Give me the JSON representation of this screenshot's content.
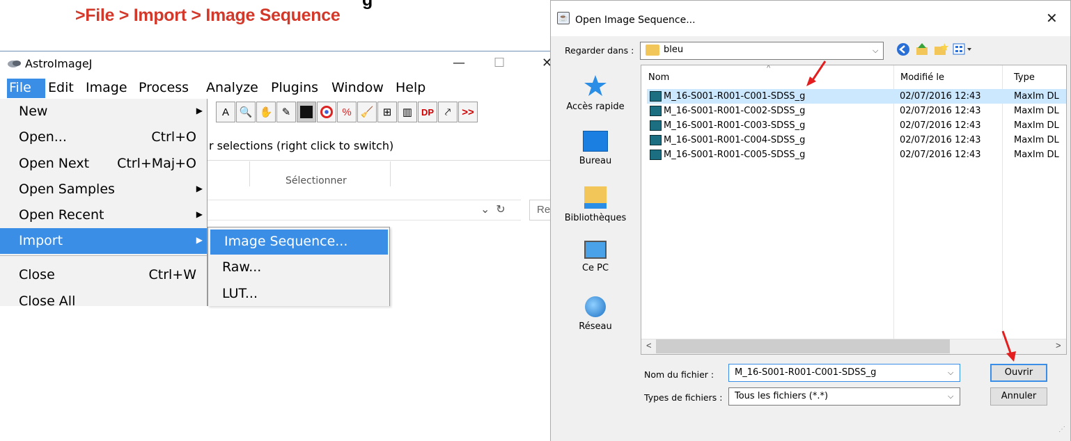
{
  "caption": ">File > Import > Image Sequence",
  "caption_cut": "g",
  "astroimagej": {
    "title": "AstroImageJ",
    "window_controls": {
      "minimize": "—",
      "maximize": "☐",
      "close": "✕"
    },
    "menu": [
      "File",
      "Edit",
      "Image",
      "Process",
      "Analyze",
      "Plugins",
      "Window",
      "Help"
    ],
    "toolbar": [
      "A",
      "🔍",
      "✋",
      "✎",
      "▦",
      "◉",
      "%",
      "🧹",
      "⊞",
      "▥",
      "DP",
      "⤤",
      ">>"
    ],
    "status": "r selections (right click to switch)",
    "file_menu": [
      {
        "label": "New",
        "shortcut": "",
        "submenu": true
      },
      {
        "label": "Open...",
        "shortcut": "Ctrl+O",
        "submenu": false
      },
      {
        "label": "Open Next",
        "shortcut": "Ctrl+Maj+O",
        "submenu": false
      },
      {
        "label": "Open Samples",
        "shortcut": "",
        "submenu": true
      },
      {
        "label": "Open Recent",
        "shortcut": "",
        "submenu": true
      },
      {
        "label": "Import",
        "shortcut": "",
        "submenu": true
      },
      {
        "label": "Close",
        "shortcut": "Ctrl+W",
        "submenu": false
      },
      {
        "label": "Close All",
        "shortcut": "",
        "submenu": false
      }
    ],
    "import_submenu": [
      "Image Sequence...",
      "Raw...",
      "LUT..."
    ]
  },
  "background": {
    "ribbon_label": "Sélectionner",
    "search_partial": "Re"
  },
  "dialog": {
    "title": "Open Image Sequence...",
    "close": "✕",
    "look_in_label": "Regarder dans :",
    "look_in_value": "bleu",
    "places": [
      "Accès rapide",
      "Bureau",
      "Bibliothèques",
      "Ce PC",
      "Réseau"
    ],
    "columns": {
      "name": "Nom",
      "modified": "Modifié le",
      "type": "Type"
    },
    "files": [
      {
        "name": "M_16-S001-R001-C001-SDSS_g",
        "modified": "02/07/2016 12:43",
        "type": "MaxIm DL"
      },
      {
        "name": "M_16-S001-R001-C002-SDSS_g",
        "modified": "02/07/2016 12:43",
        "type": "MaxIm DL"
      },
      {
        "name": "M_16-S001-R001-C003-SDSS_g",
        "modified": "02/07/2016 12:43",
        "type": "MaxIm DL"
      },
      {
        "name": "M_16-S001-R001-C004-SDSS_g",
        "modified": "02/07/2016 12:43",
        "type": "MaxIm DL"
      },
      {
        "name": "M_16-S001-R001-C005-SDSS_g",
        "modified": "02/07/2016 12:43",
        "type": "MaxIm DL"
      }
    ],
    "filename_label": "Nom du fichier :",
    "filename_value": "M_16-S001-R001-C001-SDSS_g",
    "filetype_label": "Types de fichiers :",
    "filetype_value": "Tous les fichiers (*.*)",
    "open_button": "Ouvrir",
    "cancel_button": "Annuler"
  },
  "colors": {
    "caption": "#d3392a",
    "menu_highlight": "#3a8ee6",
    "file_selected": "#cce8ff",
    "arrow": "#e41e1e"
  }
}
